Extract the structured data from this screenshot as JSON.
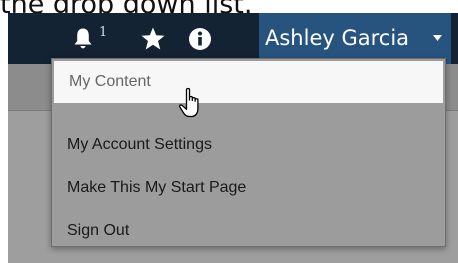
{
  "caption": "the drop down list.",
  "topbar": {
    "notifications_count": "1",
    "icons": [
      "bell-icon",
      "star-icon",
      "info-icon",
      "chevron-down-icon"
    ]
  },
  "user_menu": {
    "name": "Ashley Garcia"
  },
  "dropdown": {
    "items": [
      {
        "label": "My Content",
        "state": "hover"
      },
      {
        "label": "My Account Settings"
      },
      {
        "label": "Make This My Start Page"
      },
      {
        "label": "Sign Out"
      }
    ]
  },
  "colors": {
    "topbar": "#142333",
    "user_menu": "#27547f",
    "dropdown_bg": "#9c9c9c",
    "active_item_bg": "#f7f7f7"
  }
}
